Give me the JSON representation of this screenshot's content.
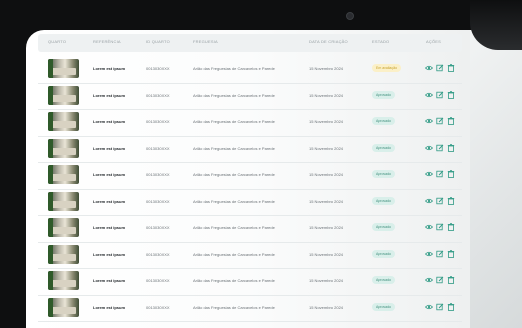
{
  "table": {
    "headers": [
      "QUARTO",
      "REFERÊNCIA",
      "ID QUARTO",
      "FREGUESIA",
      "DATA DE CRIAÇÃO",
      "ESTADO",
      "AÇÕES"
    ],
    "rows": [
      {
        "ref": "Lorem est ipsum",
        "id": "0013030XXX",
        "freguesia": "Arião das Freguesias de Carcavelos e Parede",
        "date": "15 Novembro 2024",
        "status": "Em avaliação",
        "status_type": "review"
      },
      {
        "ref": "Lorem est ipsum",
        "id": "0013030XXX",
        "freguesia": "Arião das Freguesias de Carcavelos e Parede",
        "date": "15 Novembro 2024",
        "status": "Aprovado",
        "status_type": "approved"
      },
      {
        "ref": "Lorem est ipsum",
        "id": "0013030XXX",
        "freguesia": "Arião das Freguesias de Carcavelos e Parede",
        "date": "15 Novembro 2024",
        "status": "Aprovado",
        "status_type": "approved"
      },
      {
        "ref": "Lorem est ipsum",
        "id": "0013030XXX",
        "freguesia": "Arião das Freguesias de Carcavelos e Parede",
        "date": "15 Novembro 2024",
        "status": "Aprovado",
        "status_type": "approved"
      },
      {
        "ref": "Lorem est ipsum",
        "id": "0013030XXX",
        "freguesia": "Arião das Freguesias de Carcavelos e Parede",
        "date": "15 Novembro 2024",
        "status": "Aprovado",
        "status_type": "approved"
      },
      {
        "ref": "Lorem est ipsum",
        "id": "0013030XXX",
        "freguesia": "Arião das Freguesias de Carcavelos e Parede",
        "date": "15 Novembro 2024",
        "status": "Aprovado",
        "status_type": "approved"
      },
      {
        "ref": "Lorem est ipsum",
        "id": "0013030XXX",
        "freguesia": "Arião das Freguesias de Carcavelos e Parede",
        "date": "15 Novembro 2024",
        "status": "Aprovado",
        "status_type": "approved"
      },
      {
        "ref": "Lorem est ipsum",
        "id": "0013030XXX",
        "freguesia": "Arião das Freguesias de Carcavelos e Parede",
        "date": "15 Novembro 2024",
        "status": "Aprovado",
        "status_type": "approved"
      },
      {
        "ref": "Lorem est ipsum",
        "id": "0013030XXX",
        "freguesia": "Arião das Freguesias de Carcavelos e Parede",
        "date": "15 Novembro 2024",
        "status": "Aprovado",
        "status_type": "approved"
      },
      {
        "ref": "Lorem est ipsum",
        "id": "0013030XXX",
        "freguesia": "Arião das Freguesias de Carcavelos e Parede",
        "date": "15 Novembro 2024",
        "status": "Aprovado",
        "status_type": "approved"
      }
    ]
  },
  "icons": {
    "view": "eye-icon",
    "edit": "edit-icon",
    "delete": "trash-icon"
  },
  "colors": {
    "accent": "#2e9a84",
    "approved_bg": "#d9efea",
    "review_bg": "#fbf0c8"
  }
}
